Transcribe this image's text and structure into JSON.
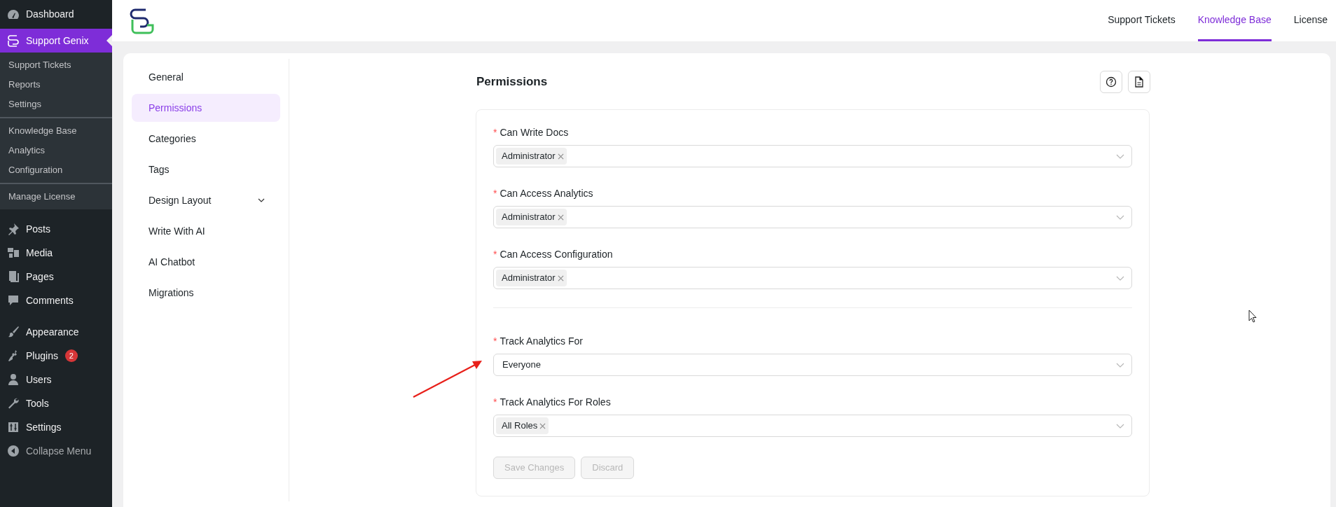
{
  "admin_menu": {
    "top_items": [
      {
        "label": "Dashboard",
        "kind": "gauge",
        "selected": false
      }
    ],
    "plugin_item": {
      "label": "Support Genix",
      "selected": true
    },
    "submenu_groups": [
      [
        "Support Tickets",
        "Reports",
        "Settings"
      ],
      [
        "Knowledge Base",
        "Analytics",
        "Configuration"
      ],
      [
        "Manage License"
      ]
    ],
    "item_groups": [
      [
        {
          "label": "Posts",
          "kind": "pin"
        },
        {
          "label": "Media",
          "kind": "media"
        },
        {
          "label": "Pages",
          "kind": "pages"
        },
        {
          "label": "Comments",
          "kind": "comment"
        }
      ],
      [
        {
          "label": "Appearance",
          "kind": "brush"
        },
        {
          "label": "Plugins",
          "kind": "plug",
          "badge": "2"
        },
        {
          "label": "Users",
          "kind": "user"
        },
        {
          "label": "Tools",
          "kind": "wrench"
        },
        {
          "label": "Settings",
          "kind": "sliders"
        }
      ]
    ],
    "collapse": "Collapse Menu"
  },
  "header": {
    "tabs": [
      {
        "label": "Support Tickets",
        "selected": false
      },
      {
        "label": "Knowledge Base",
        "selected": true
      },
      {
        "label": "License",
        "selected": false
      }
    ]
  },
  "settings_nav": [
    {
      "label": "General",
      "selected": false,
      "expandable": false
    },
    {
      "label": "Permissions",
      "selected": true,
      "expandable": false
    },
    {
      "label": "Categories",
      "selected": false,
      "expandable": false
    },
    {
      "label": "Tags",
      "selected": false,
      "expandable": false
    },
    {
      "label": "Design Layout",
      "selected": false,
      "expandable": true
    },
    {
      "label": "Write With AI",
      "selected": false,
      "expandable": false
    },
    {
      "label": "AI Chatbot",
      "selected": false,
      "expandable": false
    },
    {
      "label": "Migrations",
      "selected": false,
      "expandable": false
    }
  ],
  "panel": {
    "title": "Permissions",
    "field_groups": [
      [
        {
          "label": "Can Write Docs",
          "required_mark": "*",
          "kind": "multi",
          "tags": [
            "Administrator"
          ]
        },
        {
          "label": "Can Access Analytics",
          "required_mark": "*",
          "kind": "multi",
          "tags": [
            "Administrator"
          ]
        },
        {
          "label": "Can Access Configuration",
          "required_mark": "*",
          "kind": "multi",
          "tags": [
            "Administrator"
          ]
        }
      ],
      [
        {
          "label": "Track Analytics For",
          "required_mark": "*",
          "kind": "single",
          "value": "Everyone"
        },
        {
          "label": "Track Analytics For Roles",
          "required_mark": "*",
          "kind": "multi",
          "tags": [
            "All Roles"
          ]
        }
      ]
    ],
    "buttons": [
      {
        "label": "Save Changes",
        "disabled": true
      },
      {
        "label": "Discard",
        "disabled": true
      }
    ]
  }
}
